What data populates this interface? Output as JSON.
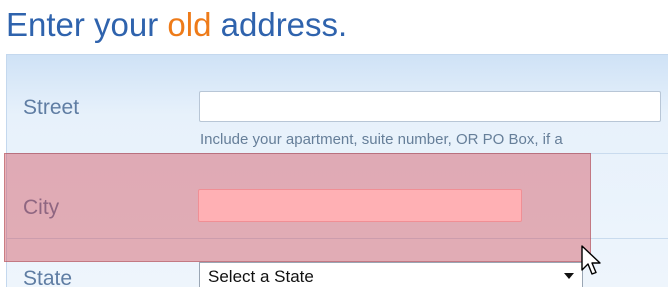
{
  "heading": {
    "before": "Enter your ",
    "accent": "old",
    "after": " address."
  },
  "form": {
    "street": {
      "label": "Street",
      "value": "",
      "hint": "Include your apartment, suite number, OR PO Box, if a"
    },
    "city": {
      "label": "City",
      "value": ""
    },
    "state": {
      "label": "State",
      "selected": "Select a State"
    }
  },
  "colors": {
    "heading": "#2f63ad",
    "accent": "#ee7b19",
    "highlight": "#d14754"
  },
  "icons": {
    "cursor": "arrow-cursor-icon",
    "dropdown": "dropdown-caret-icon"
  }
}
